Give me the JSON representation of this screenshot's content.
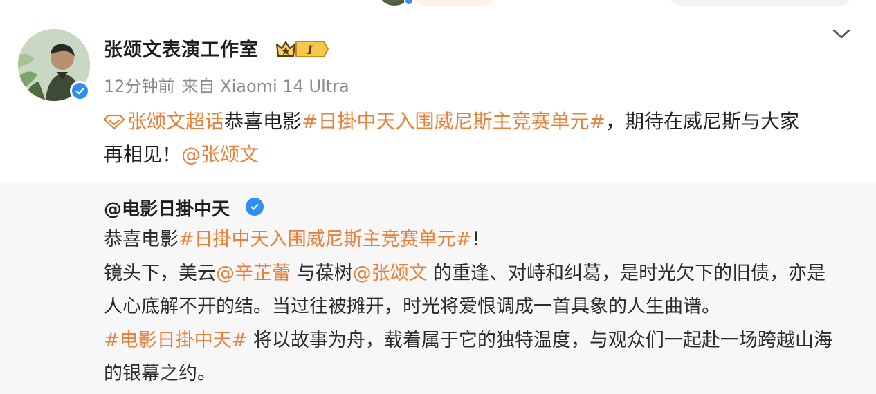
{
  "post": {
    "author": "张颂文表演工作室",
    "level_badge": "I",
    "time": "12分钟前",
    "source": "来自 Xiaomi 14 Ultra",
    "topic_link": "张颂文超话",
    "text_1": "恭喜电影",
    "hashtag": "#日掛中天入围威尼斯主竞赛单元#",
    "text_2": "，期待在威尼斯与大家",
    "text_3": "再相见！",
    "mention": "@张颂文"
  },
  "repost": {
    "author": "@电影日掛中天",
    "line1": {
      "text_a": "恭喜电影",
      "hashtag": "#日掛中天入围威尼斯主竞赛单元#",
      "text_b": "！"
    },
    "line2": {
      "text_a": "镜头下，美云",
      "mention_1": "@辛芷蕾",
      "text_b": " 与葆树",
      "mention_2": "@张颂文",
      "text_c": " 的重逢、对峙和纠葛，是时光欠下的旧债，亦是"
    },
    "line3": {
      "text_a": "人心底解不开的结。当过往被摊开，时光将爱恨调成一首具象的人生曲谱。"
    },
    "line4": {
      "hashtag": "#电影日掛中天#",
      "text_a": " 将以故事为舟，载着属于它的独特温度，与观众们一起赴一场跨越山海"
    },
    "line5": {
      "text_a": "的银幕之约。"
    }
  },
  "colors": {
    "link": "#e9803a",
    "verified": "#2f8ff0",
    "repost_bg": "#f7f7f7",
    "meta": "#8a8a8a"
  },
  "icons": {
    "verified": "verified-icon",
    "level": "crown-level-icon",
    "menu": "chevron-down-icon",
    "topic": "diamond-topic-icon"
  }
}
